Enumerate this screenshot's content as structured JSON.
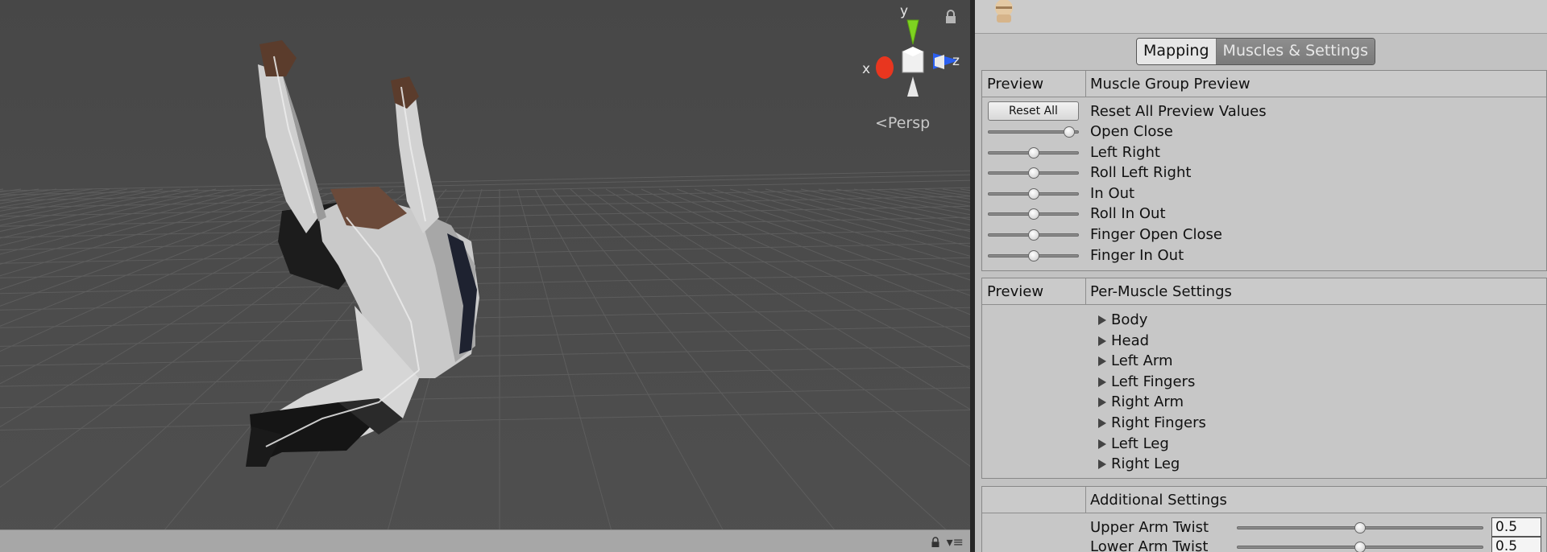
{
  "scene": {
    "gizmo": {
      "y_label": "y",
      "x_label": "x",
      "z_label": "z",
      "colors": {
        "y": "#7ed321",
        "x": "#e8361f",
        "z": "#2a5ff0"
      }
    },
    "projection_label": "Persp",
    "icons": {
      "lock": "lock-icon",
      "layers": "layers-menu-icon"
    }
  },
  "inspector": {
    "avatar_icon": "avatar-head-icon",
    "tabs": [
      {
        "label": "Mapping",
        "active": true
      },
      {
        "label": "Muscles & Settings",
        "active": false
      }
    ],
    "muscle_group": {
      "header_left": "Preview",
      "header_right": "Muscle Group Preview",
      "reset_button": "Reset All",
      "reset_label": "Reset All Preview Values",
      "sliders": [
        {
          "label": "Open Close",
          "value": 0.9
        },
        {
          "label": "Left Right",
          "value": 0.5
        },
        {
          "label": "Roll Left Right",
          "value": 0.5
        },
        {
          "label": "In Out",
          "value": 0.5
        },
        {
          "label": "Roll In Out",
          "value": 0.5
        },
        {
          "label": "Finger Open Close",
          "value": 0.5
        },
        {
          "label": "Finger In Out",
          "value": 0.5
        }
      ]
    },
    "per_muscle": {
      "header_left": "Preview",
      "header_right": "Per-Muscle Settings",
      "items": [
        "Body",
        "Head",
        "Left Arm",
        "Left Fingers",
        "Right Arm",
        "Right Fingers",
        "Left Leg",
        "Right Leg"
      ]
    },
    "additional": {
      "header_left": "",
      "header_right": "Additional Settings",
      "rows": [
        {
          "label": "Upper Arm Twist",
          "value": "0.5",
          "fraction": 0.5
        },
        {
          "label": "Lower Arm Twist",
          "value": "0.5",
          "fraction": 0.5
        }
      ]
    }
  }
}
